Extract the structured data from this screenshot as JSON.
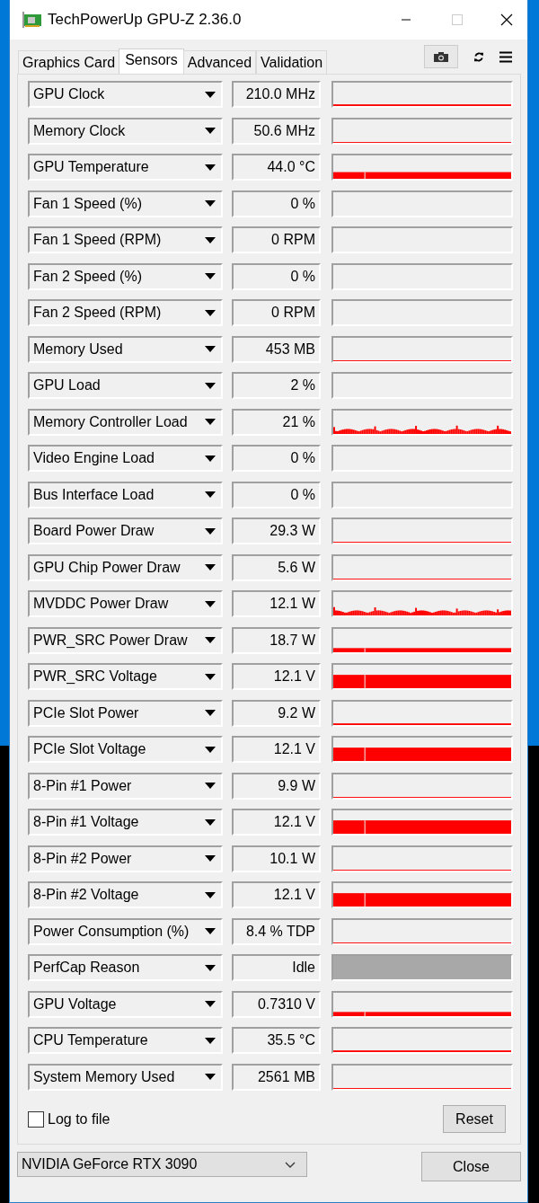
{
  "window": {
    "title": "TechPowerUp GPU-Z 2.36.0"
  },
  "tabs": [
    {
      "label": "Graphics Card",
      "selected": false
    },
    {
      "label": "Sensors",
      "selected": true
    },
    {
      "label": "Advanced",
      "selected": false
    },
    {
      "label": "Validation",
      "selected": false
    }
  ],
  "sensors": [
    {
      "name": "GPU Clock",
      "value": "210.0 MHz",
      "kind": "thin"
    },
    {
      "name": "Memory Clock",
      "value": "50.6 MHz",
      "kind": "hair"
    },
    {
      "name": "GPU Temperature",
      "value": "44.0 °C",
      "kind": "bar"
    },
    {
      "name": "Fan 1 Speed (%)",
      "value": "0 %",
      "kind": "none"
    },
    {
      "name": "Fan 1 Speed (RPM)",
      "value": "0 RPM",
      "kind": "none"
    },
    {
      "name": "Fan 2 Speed (%)",
      "value": "0 %",
      "kind": "none"
    },
    {
      "name": "Fan 2 Speed (RPM)",
      "value": "0 RPM",
      "kind": "none"
    },
    {
      "name": "Memory Used",
      "value": "453 MB",
      "kind": "hair"
    },
    {
      "name": "GPU Load",
      "value": "2 %",
      "kind": "none"
    },
    {
      "name": "Memory Controller Load",
      "value": "21 %",
      "kind": "noise"
    },
    {
      "name": "Video Engine Load",
      "value": "0 %",
      "kind": "none"
    },
    {
      "name": "Bus Interface Load",
      "value": "0 %",
      "kind": "none"
    },
    {
      "name": "Board Power Draw",
      "value": "29.3 W",
      "kind": "hair"
    },
    {
      "name": "GPU Chip Power Draw",
      "value": "5.6 W",
      "kind": "hair"
    },
    {
      "name": "MVDDC Power Draw",
      "value": "12.1 W",
      "kind": "noise"
    },
    {
      "name": "PWR_SRC Power Draw",
      "value": "18.7 W",
      "kind": "low"
    },
    {
      "name": "PWR_SRC Voltage",
      "value": "12.1 V",
      "kind": "high"
    },
    {
      "name": "PCIe Slot Power",
      "value": "9.2 W",
      "kind": "thin"
    },
    {
      "name": "PCIe Slot Voltage",
      "value": "12.1 V",
      "kind": "high"
    },
    {
      "name": "8-Pin #1 Power",
      "value": "9.9 W",
      "kind": "hair"
    },
    {
      "name": "8-Pin #1 Voltage",
      "value": "12.1 V",
      "kind": "high"
    },
    {
      "name": "8-Pin #2 Power",
      "value": "10.1 W",
      "kind": "hair"
    },
    {
      "name": "8-Pin #2 Voltage",
      "value": "12.1 V",
      "kind": "high"
    },
    {
      "name": "Power Consumption (%)",
      "value": "8.4 % TDP",
      "kind": "hair"
    },
    {
      "name": "PerfCap Reason",
      "value": "Idle",
      "kind": "gray"
    },
    {
      "name": "GPU Voltage",
      "value": "0.7310 V",
      "kind": "low"
    },
    {
      "name": "CPU Temperature",
      "value": "35.5 °C",
      "kind": "thin"
    },
    {
      "name": "System Memory Used",
      "value": "2561 MB",
      "kind": "hair"
    }
  ],
  "log_to_file": {
    "label": "Log to file",
    "checked": false
  },
  "reset_button": "Reset",
  "device_select": {
    "value": "NVIDIA GeForce RTX 3090"
  },
  "close_button": "Close"
}
